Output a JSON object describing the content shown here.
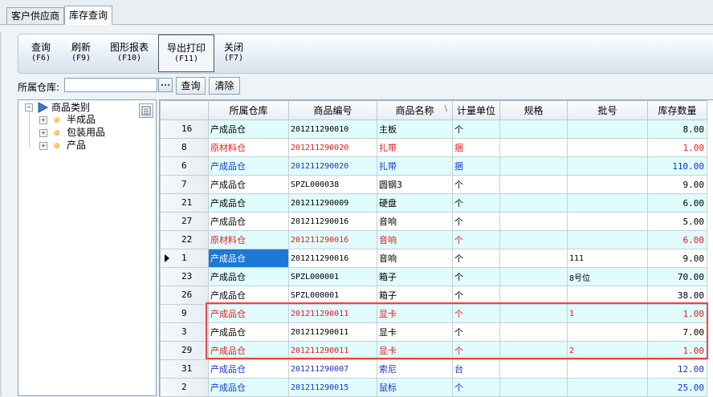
{
  "tabs": [
    {
      "label": "客户供应商"
    },
    {
      "label": "库存查询"
    }
  ],
  "toolbar": {
    "query": {
      "label": "查询",
      "key": "(F6)"
    },
    "refresh": {
      "label": "刷新",
      "key": "(F9)"
    },
    "report": {
      "label": "图形报表",
      "key": "(F10)"
    },
    "export": {
      "label": "导出打印",
      "key": "(F11)"
    },
    "close": {
      "label": "关闭",
      "key": "(F7)"
    }
  },
  "filter": {
    "label": "所属仓库:",
    "value": "",
    "browse": "...",
    "query_button": "查询",
    "clear_button": "清除"
  },
  "tree": {
    "root": {
      "label": "商品类别",
      "expander": "−"
    },
    "items": [
      {
        "label": "半成品",
        "expander": "+"
      },
      {
        "label": "包装用品",
        "expander": "+"
      },
      {
        "label": "产品",
        "expander": "+"
      }
    ]
  },
  "grid": {
    "columns": [
      "所属仓库",
      "商品编号",
      "商品名称",
      "计量单位",
      "规格",
      "批号",
      "库存数量"
    ],
    "sort_indicator": "\\",
    "rows": [
      {
        "id": "16",
        "warehouse": "产成品仓",
        "code": "201211290010",
        "name": "主板",
        "unit": "个",
        "spec": "",
        "batch": "",
        "qty": "8.00",
        "color": "black",
        "bg": "cyan"
      },
      {
        "id": "8",
        "warehouse": "原材料仓",
        "code": "201211290020",
        "name": "扎带",
        "unit": "捆",
        "spec": "",
        "batch": "",
        "qty": "1.00",
        "color": "red",
        "bg": "white"
      },
      {
        "id": "6",
        "warehouse": "产成品仓",
        "code": "201211290020",
        "name": "扎带",
        "unit": "捆",
        "spec": "",
        "batch": "",
        "qty": "110.00",
        "color": "blue",
        "bg": "cyan"
      },
      {
        "id": "7",
        "warehouse": "产成品仓",
        "code": "SPZL000038",
        "name": "圆钢3",
        "unit": "个",
        "spec": "",
        "batch": "",
        "qty": "9.00",
        "color": "black",
        "bg": "white"
      },
      {
        "id": "21",
        "warehouse": "产成品仓",
        "code": "201211290009",
        "name": "硬盘",
        "unit": "个",
        "spec": "",
        "batch": "",
        "qty": "6.00",
        "color": "black",
        "bg": "cyan"
      },
      {
        "id": "27",
        "warehouse": "产成品仓",
        "code": "201211290016",
        "name": "音响",
        "unit": "个",
        "spec": "",
        "batch": "",
        "qty": "5.00",
        "color": "black",
        "bg": "white"
      },
      {
        "id": "22",
        "warehouse": "原材料仓",
        "code": "201211290016",
        "name": "音响",
        "unit": "个",
        "spec": "",
        "batch": "",
        "qty": "6.00",
        "color": "red",
        "bg": "cyan"
      },
      {
        "id": "1",
        "warehouse": "产成品仓",
        "code": "201211290016",
        "name": "音响",
        "unit": "个",
        "spec": "",
        "batch": "111",
        "qty": "9.00",
        "color": "black",
        "bg": "white",
        "current": true
      },
      {
        "id": "23",
        "warehouse": "产成品仓",
        "code": "SPZL000001",
        "name": "箱子",
        "unit": "个",
        "spec": "",
        "batch": "8号位",
        "qty": "70.00",
        "color": "black",
        "bg": "cyan"
      },
      {
        "id": "26",
        "warehouse": "产成品仓",
        "code": "SPZL000001",
        "name": "箱子",
        "unit": "个",
        "spec": "",
        "batch": "",
        "qty": "38.00",
        "color": "black",
        "bg": "white"
      },
      {
        "id": "9",
        "warehouse": "产成品仓",
        "code": "201211290011",
        "name": "显卡",
        "unit": "个",
        "spec": "",
        "batch": "1",
        "qty": "1.00",
        "color": "red",
        "bg": "cyan"
      },
      {
        "id": "3",
        "warehouse": "产成品仓",
        "code": "201211290011",
        "name": "显卡",
        "unit": "个",
        "spec": "",
        "batch": "",
        "qty": "7.00",
        "color": "black",
        "bg": "white"
      },
      {
        "id": "29",
        "warehouse": "产成品仓",
        "code": "201211290011",
        "name": "显卡",
        "unit": "个",
        "spec": "",
        "batch": "2",
        "qty": "1.00",
        "color": "red",
        "bg": "cyan"
      },
      {
        "id": "31",
        "warehouse": "产成品仓",
        "code": "201211290007",
        "name": "索尼",
        "unit": "台",
        "spec": "",
        "batch": "",
        "qty": "12.00",
        "color": "blue",
        "bg": "white"
      },
      {
        "id": "2",
        "warehouse": "产成品仓",
        "code": "201211290015",
        "name": "鼠标",
        "unit": "个",
        "spec": "",
        "batch": "",
        "qty": "25.00",
        "color": "blue",
        "bg": "cyan"
      }
    ]
  },
  "colors": {
    "selected_cell": "#1b78d5",
    "highlight_box": "#e8473f",
    "row_alt": "#e0fcfd",
    "red_text": "#e51c1c",
    "blue_text": "#1438c2"
  }
}
